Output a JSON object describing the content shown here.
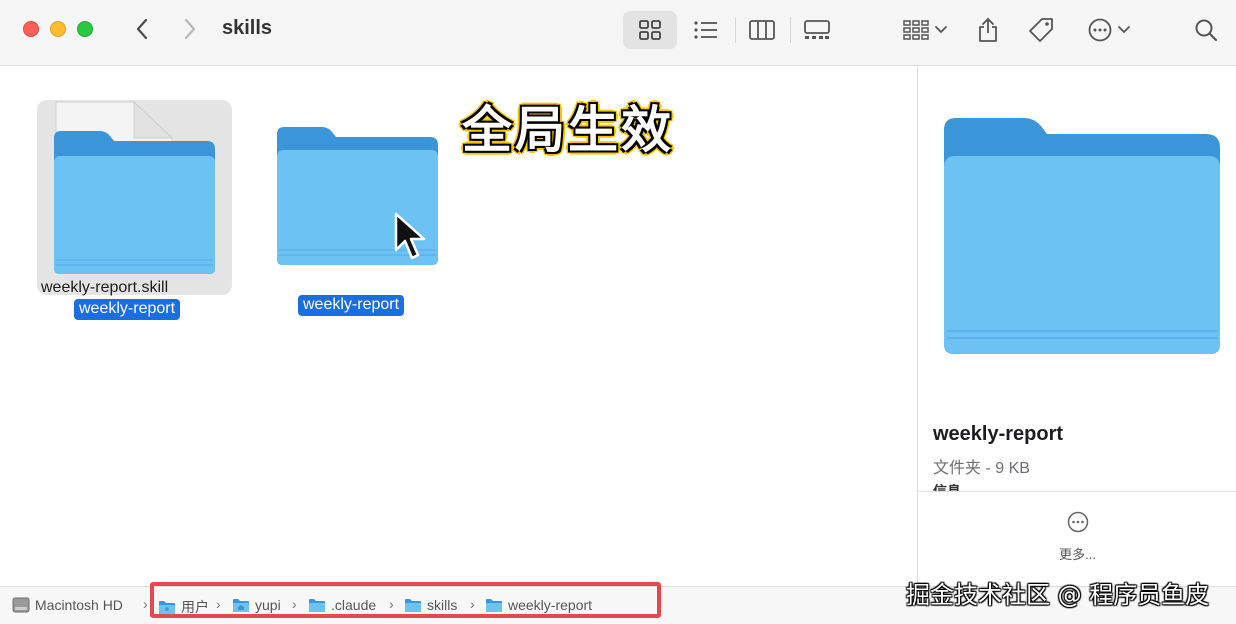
{
  "window": {
    "title": "skills"
  },
  "toolbar": {
    "buttons": [
      {
        "name": "icon-view-button",
        "icon": "grid-icon",
        "active": true
      },
      {
        "name": "list-view-button",
        "icon": "list-icon"
      },
      {
        "name": "column-view-button",
        "icon": "columns-icon"
      },
      {
        "name": "gallery-view-button",
        "icon": "gallery-icon"
      },
      {
        "name": "group-button",
        "icon": "group-icon"
      },
      {
        "name": "share-button",
        "icon": "share-icon"
      },
      {
        "name": "tag-button",
        "icon": "tag-icon"
      },
      {
        "name": "more-actions-button",
        "icon": "ellipsis-circle-icon"
      },
      {
        "name": "search-button",
        "icon": "search-icon"
      }
    ]
  },
  "files": [
    {
      "icon": "folder-with-document-icon",
      "filename": "weekly-report.skill",
      "label": "weekly-report",
      "selected": true
    },
    {
      "icon": "folder-icon",
      "label": "weekly-report",
      "selected": true
    }
  ],
  "overlay": {
    "caption": "全局生效"
  },
  "preview": {
    "name": "weekly-report",
    "meta": "文件夹 - 9 KB",
    "section_cut": "信息",
    "more_label": "更多..."
  },
  "pathbar": {
    "crumbs": [
      {
        "label": "Macintosh HD",
        "icon": "hard-drive-icon"
      },
      {
        "label": "用户",
        "icon": "folder-icon"
      },
      {
        "label": "yupi",
        "icon": "home-folder-icon"
      },
      {
        "label": ".claude",
        "icon": "folder-icon"
      },
      {
        "label": "skills",
        "icon": "folder-icon"
      },
      {
        "label": "weekly-report",
        "icon": "folder-icon"
      }
    ]
  },
  "watermark": "掘金技术社区 @ 程序员鱼皮",
  "colors": {
    "selection": "#1a6fe0",
    "folder": "#6cc2f3",
    "highlight": "#e5484d",
    "overlay_outline": "#f7c400"
  }
}
